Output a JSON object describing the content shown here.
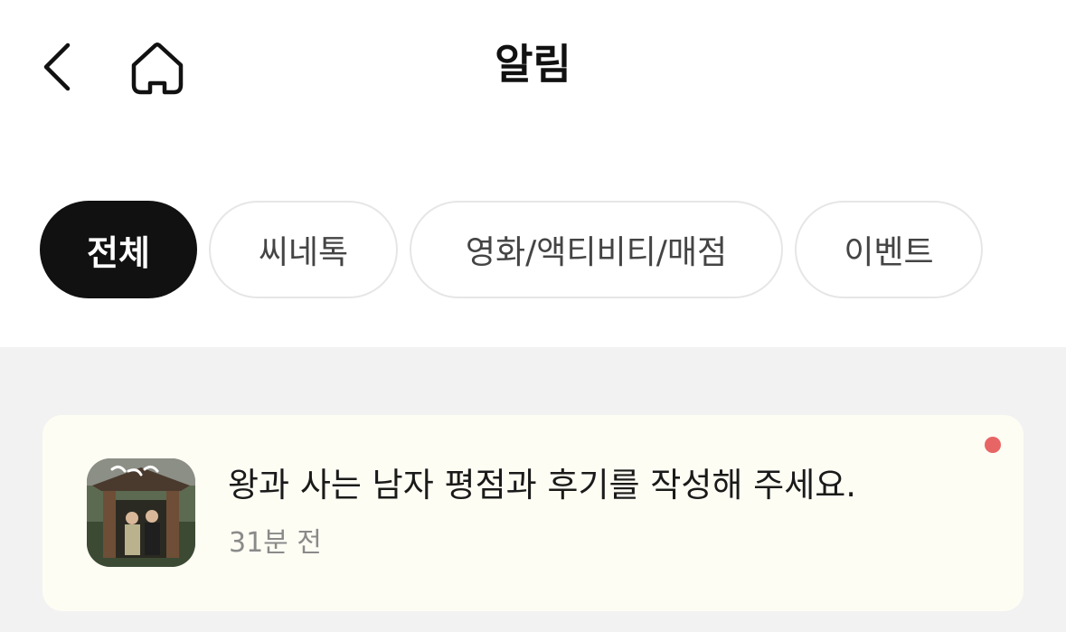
{
  "header": {
    "title": "알림",
    "back_icon": "chevron-left-icon",
    "home_icon": "home-icon"
  },
  "filters": [
    {
      "label": "전체",
      "active": true
    },
    {
      "label": "씨네톡",
      "active": false
    },
    {
      "label": "영화/액티비티/매점",
      "active": false
    },
    {
      "label": "이벤트",
      "active": false
    }
  ],
  "notifications": [
    {
      "title": "왕과 사는 남자 평점과 후기를 작성해 주세요.",
      "time": "31분 전",
      "unread": true,
      "thumbnail": "movie-poster"
    }
  ],
  "colors": {
    "accent_active_chip": "#111111",
    "unread_dot": "#e86565",
    "card_background": "#fefdf4",
    "list_background": "#f2f2f2"
  }
}
